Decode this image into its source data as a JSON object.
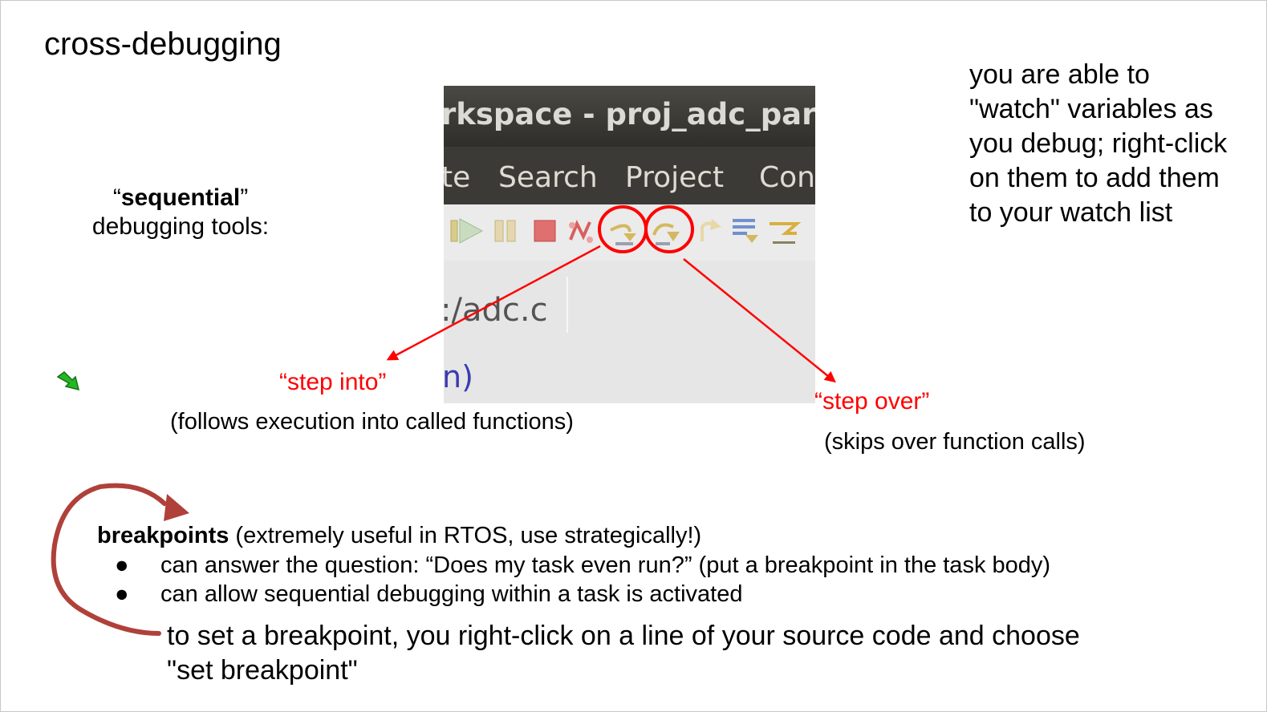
{
  "slide": {
    "title": "cross-debugging",
    "sequential": {
      "quote_open": "“",
      "bold": "sequential",
      "quote_close": "”",
      "line2": "debugging tools:"
    },
    "watch_note": "you are able to \"watch\" variables as you debug; right-click on them to add them to your watch list",
    "step_into": {
      "label": "“step into”",
      "description": "(follows execution into called functions)"
    },
    "step_over": {
      "label": "“step over”",
      "description": "(skips over function calls)"
    },
    "breakpoints": {
      "heading": "breakpoints",
      "heading_rest": " (extremely useful in RTOS, use strategically!)",
      "bullets": [
        "can answer the question: “Does my task even run?” (put a breakpoint in the task body)",
        "can allow sequential debugging within a task is activated"
      ],
      "howto": "to set a breakpoint, you right-click on a line of your source code and choose \"set breakpoint\""
    }
  },
  "ide_screenshot": {
    "window_title": "rkspace - proj_adc_pare",
    "menu_items": [
      "te",
      "Search",
      "Project",
      "Con"
    ],
    "editor_tab": ":/adc.c",
    "code_fragment": "n)",
    "toolbar_icons": [
      "resume-icon",
      "suspend-icon",
      "terminate-icon",
      "disconnect-icon",
      "step-into-icon",
      "step-over-icon",
      "step-return-icon",
      "drop-to-frame-icon",
      "use-step-filters-icon"
    ]
  },
  "colors": {
    "annotation_red": "#ff0000",
    "pen_mark": "#b0403a",
    "cursor_green": "#22b822"
  }
}
